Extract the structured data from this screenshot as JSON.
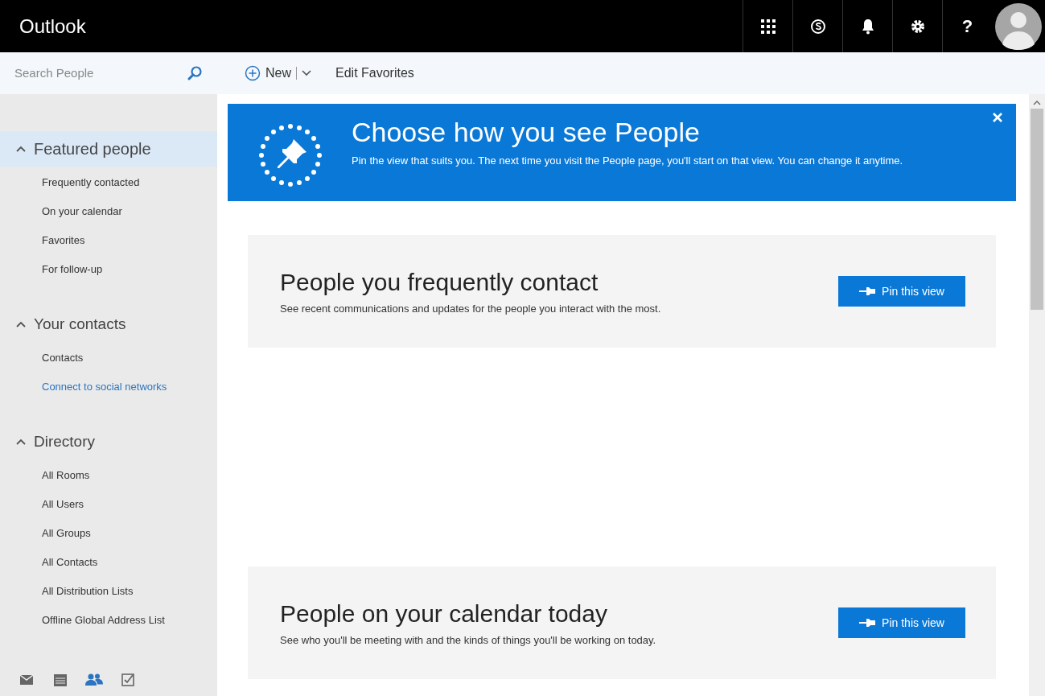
{
  "header": {
    "title": "Outlook",
    "help": "?"
  },
  "search": {
    "placeholder": "Search People"
  },
  "toolbar": {
    "new_label": "New",
    "edit_favorites": "Edit Favorites"
  },
  "sidebar": {
    "sections": [
      {
        "heading": "Featured people",
        "selected": true,
        "expanded": true,
        "items": [
          {
            "label": "Frequently contacted",
            "kind": "item"
          },
          {
            "label": "On your calendar",
            "kind": "item"
          },
          {
            "label": "Favorites",
            "kind": "item"
          },
          {
            "label": "For follow-up",
            "kind": "item"
          }
        ]
      },
      {
        "heading": "Your contacts",
        "selected": false,
        "expanded": true,
        "items": [
          {
            "label": "Contacts",
            "kind": "item"
          },
          {
            "label": "Connect to social networks",
            "kind": "link"
          }
        ]
      },
      {
        "heading": "Directory",
        "selected": false,
        "expanded": true,
        "items": [
          {
            "label": "All Rooms",
            "kind": "item"
          },
          {
            "label": "All Users",
            "kind": "item"
          },
          {
            "label": "All Groups",
            "kind": "item"
          },
          {
            "label": "All Contacts",
            "kind": "item"
          },
          {
            "label": "All Distribution Lists",
            "kind": "item"
          },
          {
            "label": "Offline Global Address List",
            "kind": "item"
          }
        ]
      }
    ]
  },
  "app_switcher": [
    {
      "kind": "mail",
      "selected": false
    },
    {
      "kind": "calendar",
      "selected": false
    },
    {
      "kind": "people",
      "selected": true
    },
    {
      "kind": "tasks",
      "selected": false
    }
  ],
  "banner": {
    "title": "Choose how you see People",
    "text": "Pin the view that suits you. The next time you visit the People page, you'll start on that view. You can change it anytime."
  },
  "cards": [
    {
      "title": "People you frequently contact",
      "text": "See recent communications and updates for the people you interact with the most.",
      "button": "Pin this view"
    },
    {
      "title": "People on your calendar today",
      "text": "See who you'll be meeting with and the kinds of things you'll be working on today.",
      "button": "Pin this view"
    }
  ]
}
